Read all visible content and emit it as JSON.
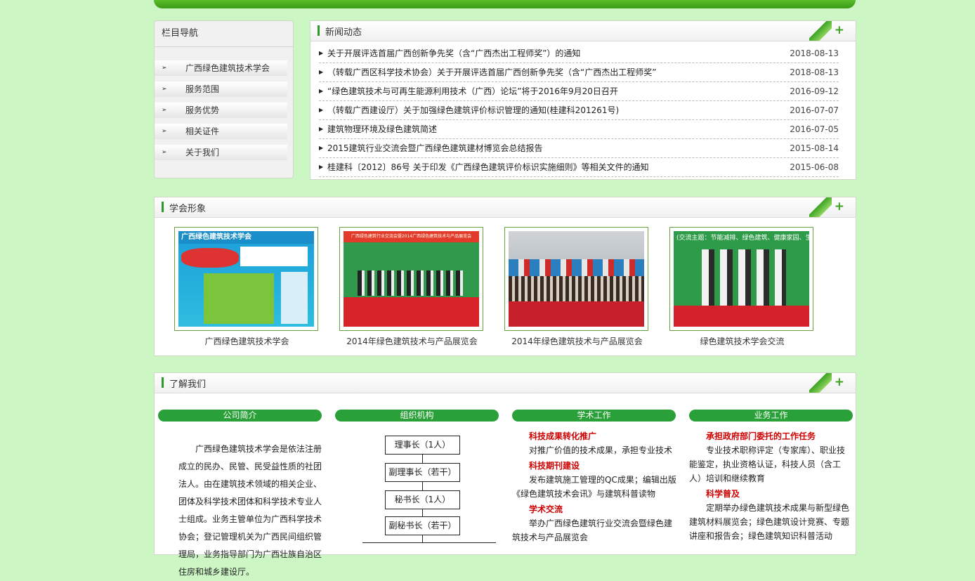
{
  "nav": {
    "title": "栏目导航",
    "items": [
      "广西绿色建筑技术学会",
      "服务范围",
      "服务优势",
      "相关证件",
      "关于我们"
    ]
  },
  "news": {
    "title": "新闻动态",
    "items": [
      {
        "title": "关于开展评选首届广西创新争先奖（含“广西杰出工程师奖”）的通知",
        "date": "2018-08-13"
      },
      {
        "title": "（转载广西区科学技术协会）关于开展评选首届广西创新争先奖（含“广西杰出工程师奖”",
        "date": "2018-08-13"
      },
      {
        "title": "“绿色建筑技术与可再生能源利用技术（广西）论坛”将于2016年9月20日召开",
        "date": "2016-09-12"
      },
      {
        "title": "（转载广西建设厅）关于加强绿色建筑评价标识管理的通知(桂建科201261号)",
        "date": "2016-07-07"
      },
      {
        "title": "建筑物理环境及绿色建筑简述",
        "date": "2016-07-05"
      },
      {
        "title": "2015建筑行业交流会暨广西绿色建筑建材博览会总结报告",
        "date": "2015-08-14"
      },
      {
        "title": "桂建科〔2012〕86号 关于印发《广西绿色建筑评价标识实施细则》等相关文件的通知",
        "date": "2015-06-08"
      }
    ]
  },
  "gallery": {
    "title": "学会形象",
    "photos": [
      {
        "caption": "广西绿色建筑技术学会",
        "poster_title": "广西绿色建筑技术学会"
      },
      {
        "caption": "2014年绿色建筑技术与产品展览会",
        "banner": "广西绿色建筑行业交流会暨2014广西绿色建筑技术与产品展览会"
      },
      {
        "caption": "2014年绿色建筑技术与产品展览会"
      },
      {
        "caption": "绿色建筑技术学会交流",
        "banner": "(交流主题：节能减排、绿色建筑、健康家园、生"
      }
    ]
  },
  "about": {
    "title": "了解我们",
    "columns": [
      "公司简介",
      "组织机构",
      "学术工作",
      "业务工作"
    ],
    "intro": "广西绿色建筑技术学会是依法注册成立的民办、民管、民受益性质的社团法人。由在建筑技术领域的相关企业、团体及科学技术团体和科学技术专业人士组成。业务主管单位为广西科学技术协会；登记管理机关为广西民间组织管理局，业务指导部门为广西壮族自治区住房和城乡建设厅。",
    "org": [
      "理事长（1人）",
      "副理事长（若干）",
      "秘书长（1人）",
      "副秘书长（若干）"
    ],
    "academic": [
      {
        "heading": "科技成果转化推广",
        "text": "对推广价值的技术成果，承担专业技术"
      },
      {
        "heading": "科技期刊建设",
        "text": "发布建筑施工管理的QC成果；编辑出版《绿色建筑技术会讯》与建筑科普读物"
      },
      {
        "heading": "学术交流",
        "text": "举办广西绿色建筑行业交流会暨绿色建筑技术与产品展览会"
      }
    ],
    "business": [
      {
        "heading": "承担政府部门委托的工作任务",
        "text": "专业技术职称评定（专家库）、职业技能鉴定，执业资格认证，科技人员（含工人）培训和继续教育"
      },
      {
        "heading": "科学普及",
        "text": "定期举办绿色建筑技术成果与新型绿色建筑材料展览会；绿色建筑设计竞赛、专题讲座和报告会；绿色建筑知识科普活动"
      }
    ]
  },
  "ui": {
    "more": "+",
    "arrow": "➢",
    "bullet": "▶"
  }
}
